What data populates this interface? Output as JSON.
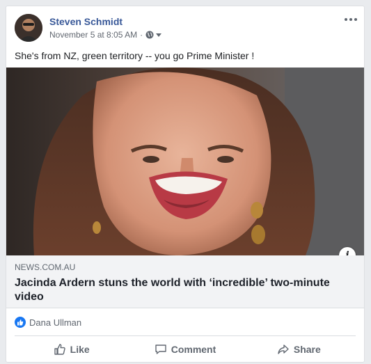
{
  "post": {
    "author": "Steven Schmidt",
    "timestamp": "November 5 at 8:05 AM",
    "separator": "·",
    "privacy_icon": "globe-icon",
    "text": "She's from NZ, green territory -- you go Prime Minister !"
  },
  "link_preview": {
    "domain": "NEWS.COM.AU",
    "title": "Jacinda Ardern stuns the world with ‘incredible’ two-minute video"
  },
  "reactions": {
    "icon": "like-icon",
    "names": "Dana Ullman"
  },
  "actions": {
    "like": "Like",
    "comment": "Comment",
    "share": "Share"
  },
  "colors": {
    "author_link": "#385898",
    "like_blue": "#1877f2",
    "secondary_text": "#606770",
    "link_meta_bg": "#f2f3f5"
  }
}
